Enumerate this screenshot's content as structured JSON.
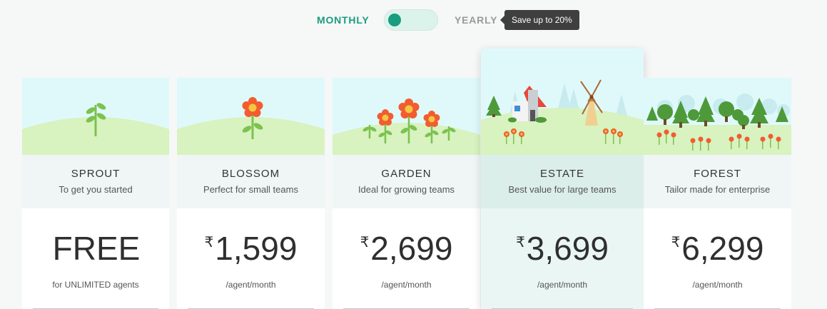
{
  "toggle": {
    "monthly_label": "MONTHLY",
    "yearly_label": "YEARLY",
    "savings_tooltip": "Save up to 20%",
    "state": "monthly"
  },
  "colors": {
    "accent": "#1a9c7e",
    "sky": "#dff9fb",
    "hill": "#d8f2c0",
    "flower": "#f25c2f"
  },
  "plans": [
    {
      "name": "SPROUT",
      "tagline": "To get you started",
      "price": "FREE",
      "currency": "",
      "period": "for UNLIMITED agents",
      "illustration": "sprout-icon"
    },
    {
      "name": "BLOSSOM",
      "tagline": "Perfect for small teams",
      "price": "1,599",
      "currency": "₹",
      "period": "/agent/month",
      "illustration": "flower-icon"
    },
    {
      "name": "GARDEN",
      "tagline": "Ideal for growing teams",
      "price": "2,699",
      "currency": "₹",
      "period": "/agent/month",
      "illustration": "garden-icon"
    },
    {
      "name": "ESTATE",
      "tagline": "Best value for large teams",
      "price": "3,699",
      "currency": "₹",
      "period": "/agent/month",
      "illustration": "estate-icon",
      "highlighted": true
    },
    {
      "name": "FOREST",
      "tagline": "Tailor made for enterprise",
      "price": "6,299",
      "currency": "₹",
      "period": "/agent/month",
      "illustration": "forest-icon"
    }
  ]
}
